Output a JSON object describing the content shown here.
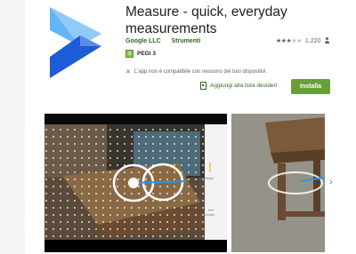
{
  "app": {
    "title": "Measure - quick, everyday measurements",
    "developer": "Google LLC",
    "category": "Strumenti",
    "rating_count": "1.220",
    "stars_filled": 3,
    "stars_total": 5,
    "pegi_label": "PEGI 3",
    "compat_notice": "L'app non è compatibile con nessuno dei tuoi dispositivi.",
    "wishlist_label": "Aggiungi alla lista desideri",
    "install_label": "Installa"
  },
  "screenshot1": {
    "height_label": "Height",
    "length_label": "Length"
  },
  "icons": {
    "app": "measure-app-icon",
    "warning": "warning-icon",
    "bookmark": "bookmark-icon",
    "person": "person-icon",
    "next": "chevron-right-icon"
  },
  "colors": {
    "accent_green": "#689f38",
    "dev_green": "#33691e",
    "icon_blue_light": "#90caf9",
    "icon_blue_mid": "#64b5f6",
    "icon_blue_dark": "#1e5bd6"
  }
}
